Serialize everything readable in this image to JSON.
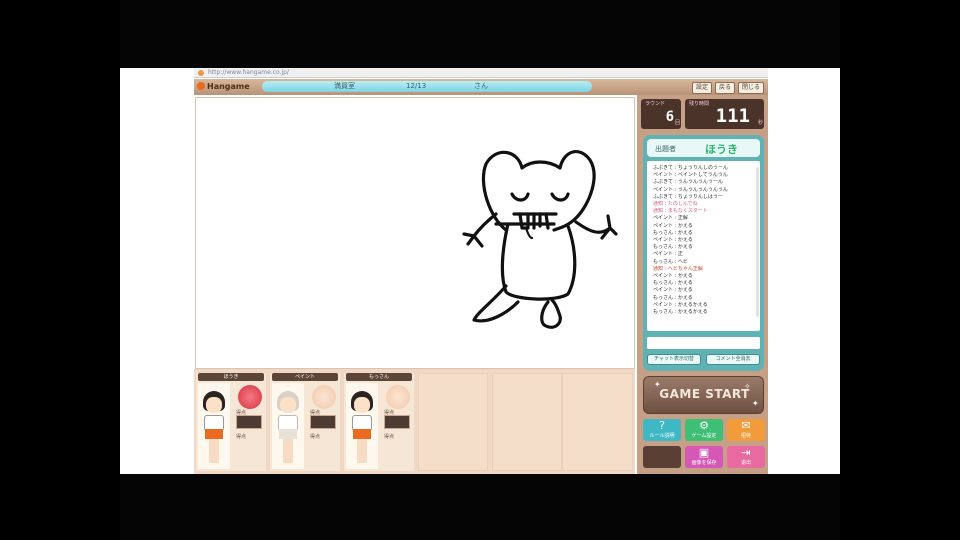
{
  "browser": {
    "url": "http://www.hangame.co.jp/"
  },
  "app": {
    "logo": "Hangame",
    "status": {
      "room": "満員室",
      "level": "12/13",
      "name": "さん"
    },
    "top_buttons": [
      "設定",
      "戻る",
      "閉じる"
    ]
  },
  "counters": {
    "round": {
      "label": "ラウンド",
      "value": "6",
      "unit": "回"
    },
    "time": {
      "label": "残り時間",
      "value": "111",
      "unit": "秒"
    }
  },
  "chat": {
    "header_label": "出題者",
    "header_value": "ほうき",
    "lines": [
      {
        "text": "ふぶきて : ちょうりんしのうーん",
        "tone": "normal"
      },
      {
        "text": "ペイント : ペイントしてうんうん",
        "tone": "normal"
      },
      {
        "text": "ふぶきて : うんうんうんうーん",
        "tone": "normal"
      },
      {
        "text": "ペイント : うんうんうんうんうん",
        "tone": "normal"
      },
      {
        "text": "ふぶきて : ちょうりんしはうー",
        "tone": "normal"
      },
      {
        "text": "通知 : たのしんでね",
        "tone": "pink"
      },
      {
        "text": "通知 : まもなくスタート",
        "tone": "pink"
      },
      {
        "text": "ペイント : 正解",
        "tone": "normal"
      },
      {
        "text": "ペイント : かえる",
        "tone": "normal"
      },
      {
        "text": "もっさん : かえる",
        "tone": "normal"
      },
      {
        "text": "ペイント : かえる",
        "tone": "normal"
      },
      {
        "text": "もっさん : かえる",
        "tone": "normal"
      },
      {
        "text": "ペイント : 正",
        "tone": "normal"
      },
      {
        "text": "もっさん : ヘビ",
        "tone": "normal"
      },
      {
        "text": "通知 : ヘビちゃん正解",
        "tone": "red"
      },
      {
        "text": "ペイント : かえる",
        "tone": "normal"
      },
      {
        "text": "もっさん : かえる",
        "tone": "normal"
      },
      {
        "text": "ペイント : かえる",
        "tone": "normal"
      },
      {
        "text": "もっさん : かえる",
        "tone": "normal"
      },
      {
        "text": "ペイント : かえるかえる",
        "tone": "normal"
      },
      {
        "text": "もっさん : かえるかえる",
        "tone": "normal"
      }
    ],
    "buttons": [
      "チャット表示切替",
      "コメント全消去"
    ]
  },
  "game_start": "GAME START",
  "action_buttons": [
    {
      "label": "ルール説明",
      "color": "#3fb8c6",
      "icon": "help-icon"
    },
    {
      "label": "ゲーム設定",
      "color": "#3fbe75",
      "icon": "settings-icon"
    },
    {
      "label": "招待",
      "color": "#f29b3a",
      "icon": "invite-icon"
    },
    {
      "label": "",
      "color": "#5a3f35",
      "icon": "blank-icon"
    },
    {
      "label": "画像を保存",
      "color": "#d557b6",
      "icon": "save-icon"
    },
    {
      "label": "退出",
      "color": "#e86aa0",
      "icon": "exit-icon"
    }
  ],
  "players": [
    {
      "name": "ほうき",
      "score_label": "得点",
      "badge": "#e7525c",
      "presenter": true
    },
    {
      "name": "ペイント",
      "score_label": "得点",
      "badge": "#f2c7aa",
      "presenter": false
    },
    {
      "name": "もっさん",
      "score_label": "得点",
      "badge": "#f2c7aa",
      "presenter": false
    }
  ]
}
